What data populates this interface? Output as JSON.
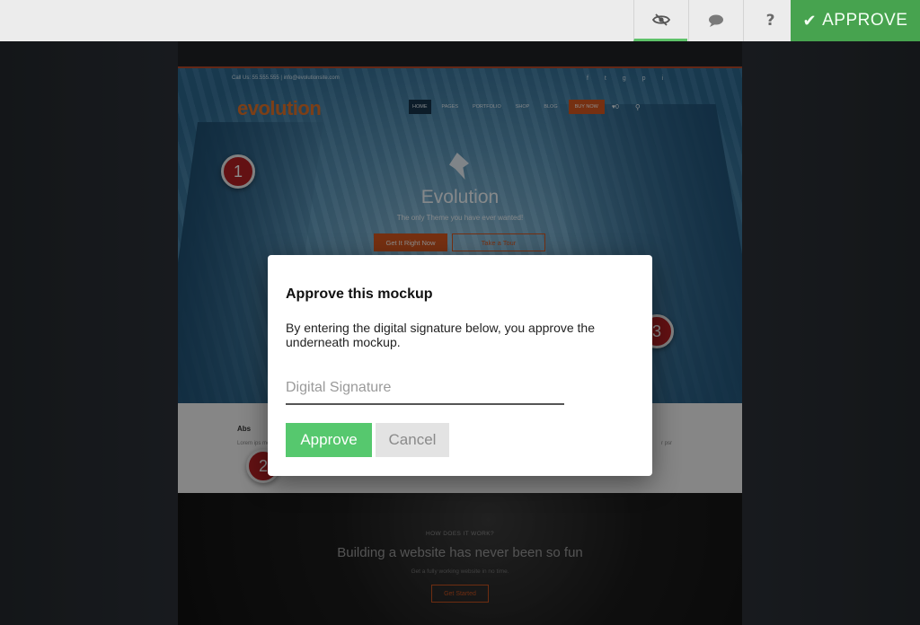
{
  "toolbar": {
    "approve_label": "APPROVE",
    "help_label": "?",
    "accent_color": "#47a34f",
    "icons": [
      "eye-slash-icon",
      "comment-icon",
      "help-icon",
      "check-icon"
    ]
  },
  "mockup": {
    "topline": "Call Us: 55.555.555 | info@evolutionsite.com",
    "logo": "evolution",
    "nav": [
      "HOME",
      "PAGES",
      "PORTFOLIO",
      "SHOP",
      "BLOG"
    ],
    "buy_label": "BUY NOW",
    "cart_count": "0",
    "hero_title": "Evolution",
    "hero_subtitle": "The only Theme you have ever wanted!",
    "hero_button_primary": "Get It Right Now",
    "hero_button_secondary": "Take a Tour",
    "pins": [
      "1",
      "2",
      "3"
    ],
    "about_title": "Abs",
    "about_text_left": "Lorem ips mc",
    "about_text_right": "r psr",
    "dark_kicker": "HOW DOES IT WORK?",
    "dark_title": "Building a website has never been so fun",
    "dark_subtitle": "Get a fully working website in no time.",
    "dark_button": "Get Started"
  },
  "modal": {
    "title": "Approve this mockup",
    "description": "By entering the digital signature below, you approve the underneath mockup.",
    "signature_placeholder": "Digital Signature",
    "signature_value": "",
    "approve_label": "Approve",
    "cancel_label": "Cancel",
    "approve_color": "#56c86e"
  }
}
